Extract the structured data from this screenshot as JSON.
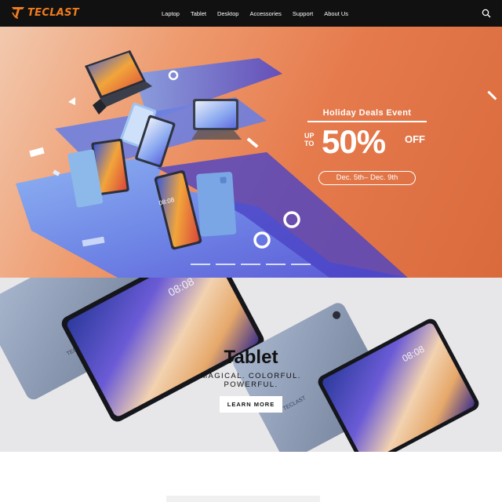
{
  "brand": {
    "name": "TECLAST",
    "color": "#f07c1e"
  },
  "nav": {
    "items": [
      "Laptop",
      "Tablet",
      "Desktop",
      "Accessories",
      "Support",
      "About Us"
    ]
  },
  "icons": {
    "search": "search-icon",
    "logo": "teclast-logo-icon",
    "arrow": "chevron-right-icon"
  },
  "hero": {
    "event_title": "Holiday Deals Event",
    "up_line1": "UP",
    "up_line2": "TO",
    "percent": "50%",
    "off": "OFF",
    "dates": "Dec. 5th– Dec. 9th",
    "slide_count": 5,
    "tablet_clock": "08:08"
  },
  "tablet_banner": {
    "title": "Tablet",
    "tagline": "MAGICAL. COLORFUL. POWERFUL.",
    "button_label": "LEARN MORE",
    "clock": "08:08",
    "device_brand": "TECLAST"
  }
}
